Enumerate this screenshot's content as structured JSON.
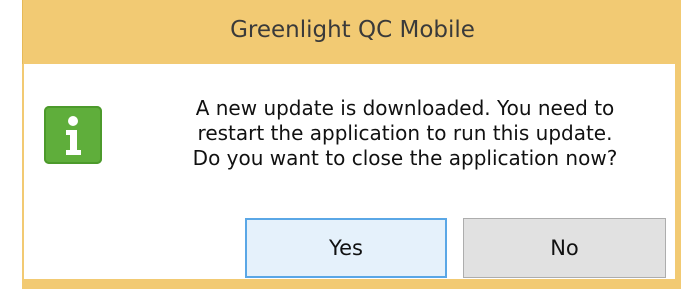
{
  "window": {
    "title": "Greenlight QC Mobile"
  },
  "dialog": {
    "icon": "info-icon",
    "message_lines": [
      "A new update is downloaded.  You need to",
      "restart the application to run this update.",
      "Do you want to close the application now?"
    ],
    "buttons": {
      "yes_label": "Yes",
      "no_label": "No"
    }
  },
  "colors": {
    "titlebar": "#f2ca73",
    "icon_green": "#5fae3b",
    "default_button_border": "#5aa7e6"
  }
}
